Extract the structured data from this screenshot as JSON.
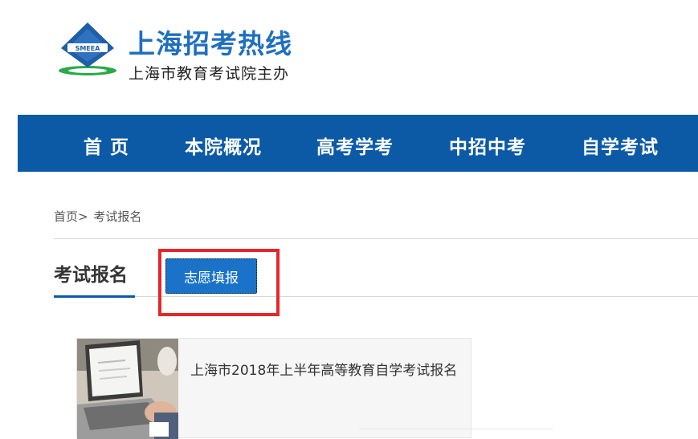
{
  "header": {
    "logo_text": "SMEEA",
    "title": "上海招考热线",
    "subtitle": "上海市教育考试院主办"
  },
  "nav": {
    "items": [
      "首 页",
      "本院概况",
      "高考学考",
      "中招中考",
      "自学考试"
    ]
  },
  "breadcrumb": {
    "home": "首页>",
    "current": "考试报名"
  },
  "section": {
    "title": "考试报名",
    "tab_button": "志愿填报"
  },
  "cards": [
    {
      "title": "上海市2018年上半年高等教育自学考试报名"
    }
  ],
  "colors": {
    "brand_blue": "#0c5aa6",
    "button_blue": "#1a73c8",
    "highlight_red": "#e3272d"
  }
}
